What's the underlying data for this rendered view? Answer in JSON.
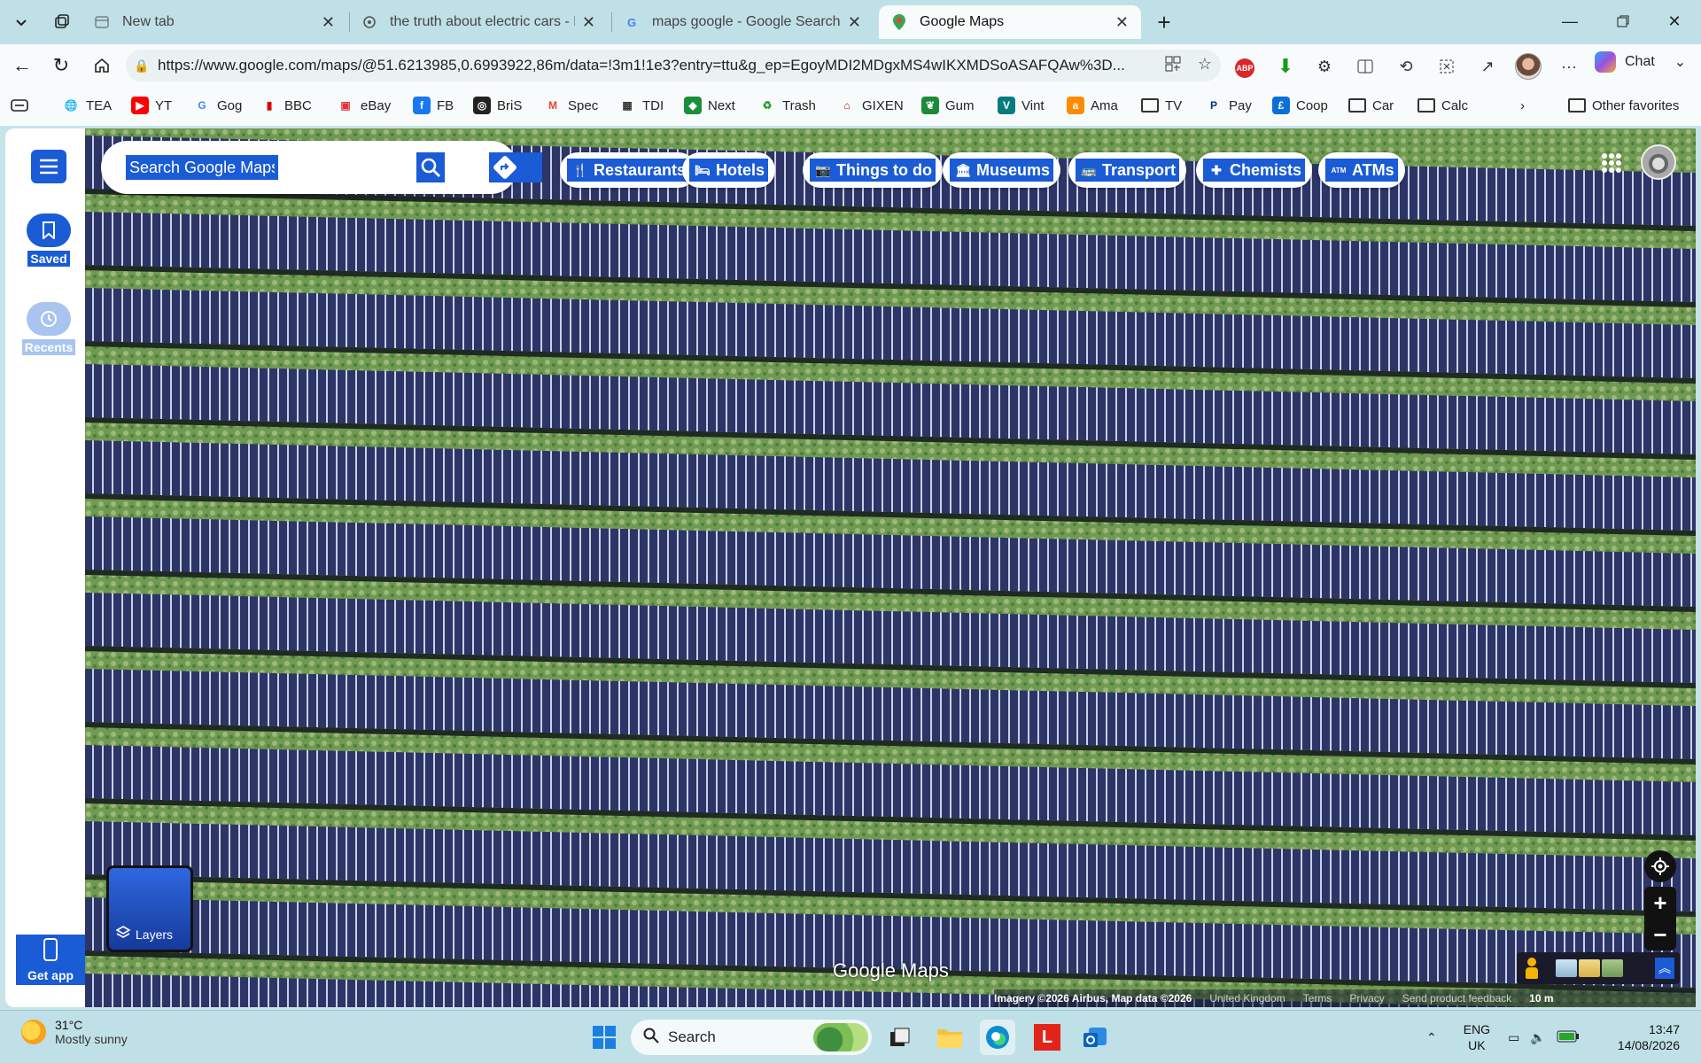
{
  "browser": {
    "tabs": [
      {
        "title": "New tab",
        "favicon": "edge-newtab-icon",
        "active": false
      },
      {
        "title": "the truth about electric cars - Page",
        "favicon": "page-icon",
        "active": false
      },
      {
        "title": "maps google - Google Search",
        "favicon": "google-g-icon",
        "active": false
      },
      {
        "title": "Google Maps",
        "favicon": "maps-pin-icon",
        "active": true
      }
    ],
    "address_url": "https://www.google.com/maps/@51.6213985,0.6993922,86m/data=!3m1!1e3?entry=ttu&g_ep=EgoyMDI2MDgxMS4wIKXMDSoASAFQAw%3D...",
    "chat_label": "Chat",
    "favorites": [
      {
        "label": "TEA",
        "icon": "globe-icon"
      },
      {
        "label": "YT",
        "icon": "youtube-icon"
      },
      {
        "label": "Gog",
        "icon": "google-icon"
      },
      {
        "label": "BBC",
        "icon": "bbc-icon"
      },
      {
        "label": "eBay",
        "icon": "ebay-icon"
      },
      {
        "label": "FB",
        "icon": "facebook-icon"
      },
      {
        "label": "BriS",
        "icon": "bris-icon"
      },
      {
        "label": "Spec",
        "icon": "gmail-icon"
      },
      {
        "label": "TDI",
        "icon": "tdi-icon"
      },
      {
        "label": "Next",
        "icon": "next-icon"
      },
      {
        "label": "Trash",
        "icon": "recycle-icon"
      },
      {
        "label": "GIXEN",
        "icon": "gixen-icon"
      },
      {
        "label": "Gum",
        "icon": "gumtree-icon"
      },
      {
        "label": "Vint",
        "icon": "vinted-icon"
      },
      {
        "label": "Ama",
        "icon": "amazon-icon"
      },
      {
        "label": "TV",
        "icon": "folder-icon"
      },
      {
        "label": "Pay",
        "icon": "paypal-icon"
      },
      {
        "label": "Coop",
        "icon": "coop-icon"
      },
      {
        "label": "Car",
        "icon": "folder-icon"
      },
      {
        "label": "Calc",
        "icon": "folder-icon"
      }
    ],
    "other_favorites": "Other favorites"
  },
  "maps": {
    "search_placeholder": "Search Google Maps",
    "rail": {
      "saved": "Saved",
      "recents": "Recents",
      "get_app": "Get app"
    },
    "chips": [
      {
        "label": "Restaurants",
        "icon": "fork-knife-icon"
      },
      {
        "label": "Hotels",
        "icon": "bed-icon"
      },
      {
        "label": "Things to do",
        "icon": "camera-icon"
      },
      {
        "label": "Museums",
        "icon": "museum-icon"
      },
      {
        "label": "Transport",
        "icon": "bus-icon"
      },
      {
        "label": "Chemists",
        "icon": "pharmacy-icon"
      },
      {
        "label": "ATMs",
        "icon": "atm-icon"
      }
    ],
    "layers_label": "Layers",
    "logo_text": "Google Maps",
    "attribution": {
      "imagery": "Imagery ©2026 Airbus, Map data ©2026",
      "region": "United Kingdom",
      "terms": "Terms",
      "privacy": "Privacy",
      "feedback": "Send product feedback",
      "scale": "10 m"
    },
    "accent_color": "#1a5bd6"
  },
  "taskbar": {
    "weather_temp": "31°C",
    "weather_desc": "Mostly sunny",
    "search_label": "Search",
    "lang_top": "ENG",
    "lang_bottom": "UK",
    "time": "13:47",
    "date": "14/08/2026"
  }
}
